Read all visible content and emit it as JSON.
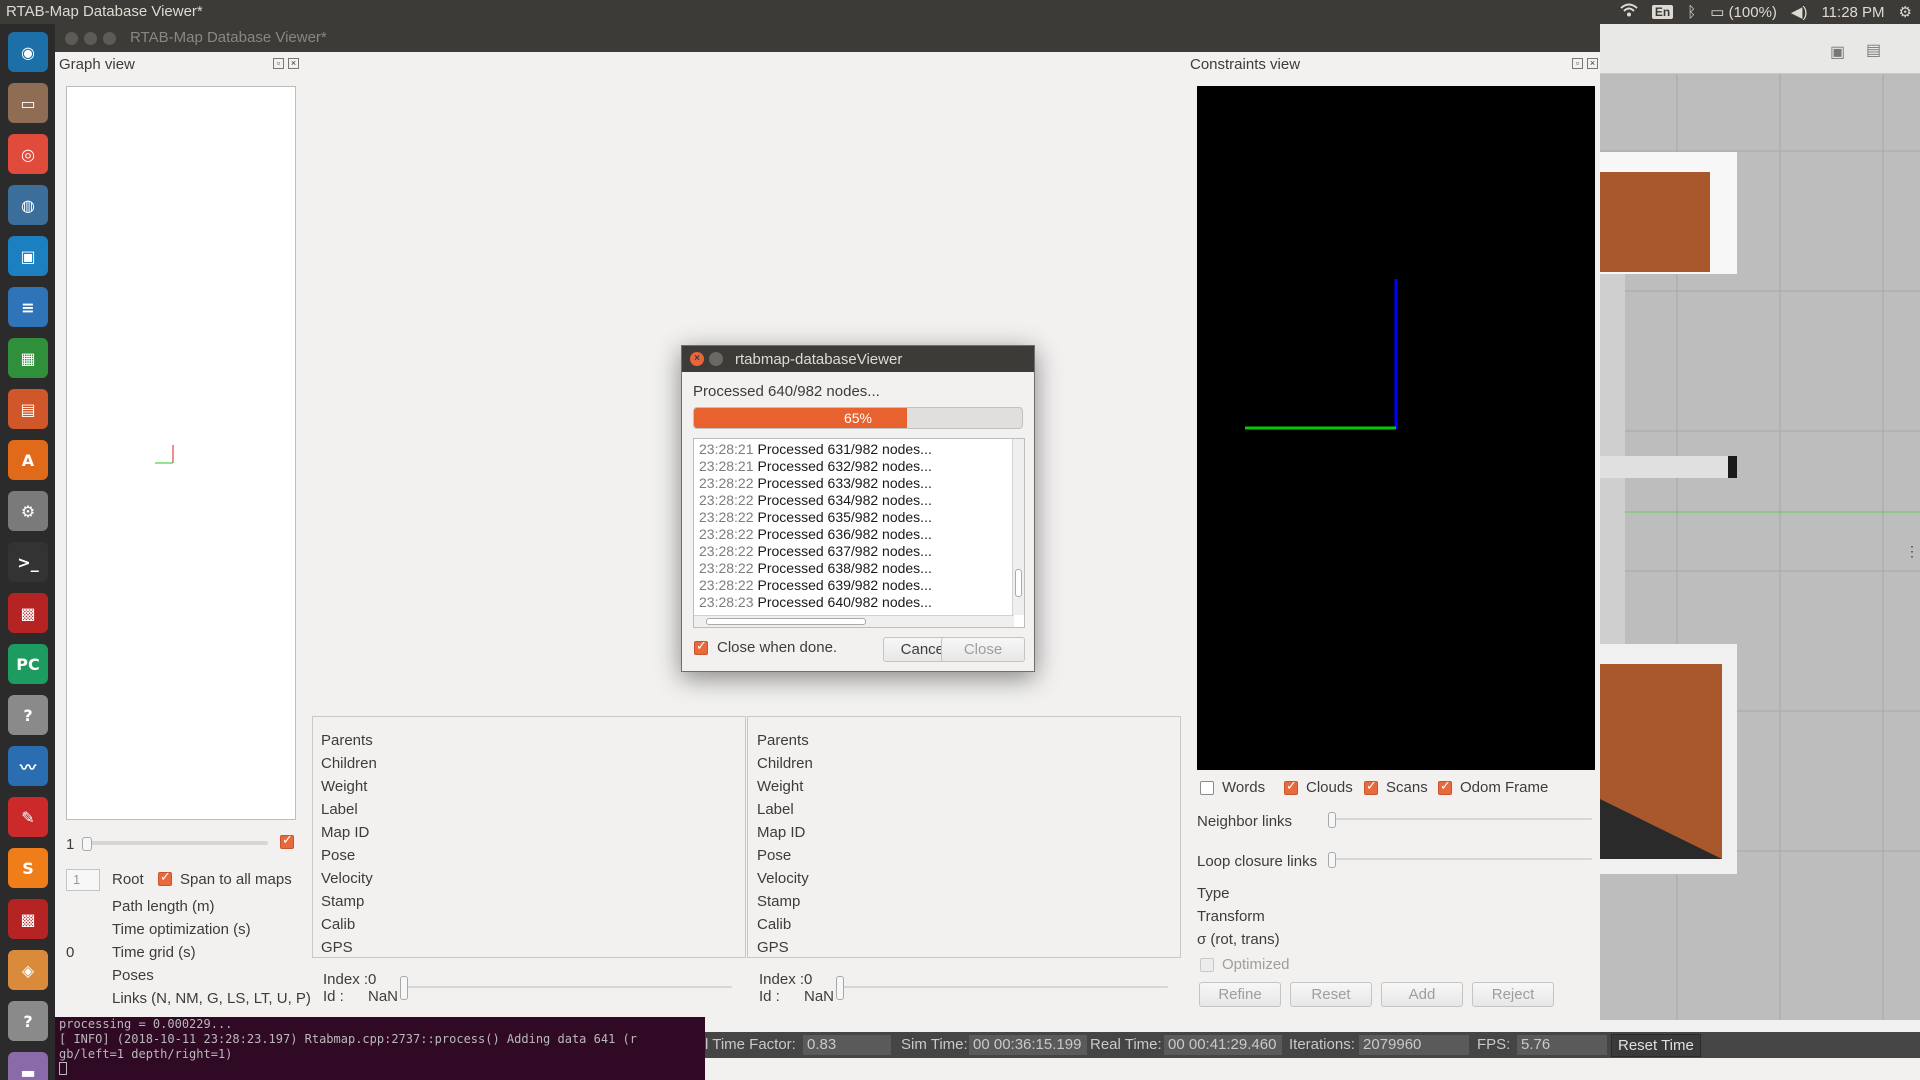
{
  "system": {
    "app_title": "RTAB-Map Database Viewer*",
    "language": "En",
    "battery": "(100%)",
    "clock": "11:28 PM"
  },
  "window": {
    "title": "RTAB-Map Database Viewer*"
  },
  "launcher": {
    "items": [
      {
        "name": "ubuntu-dash-icon",
        "glyph": "◉",
        "color": "#1d6fa8"
      },
      {
        "name": "files-icon",
        "glyph": "▭",
        "color": "#8e6d54"
      },
      {
        "name": "chrome-icon",
        "glyph": "◎",
        "color": "#e14b3b"
      },
      {
        "name": "network-icon",
        "glyph": "◍",
        "color": "#3c6e9c"
      },
      {
        "name": "virtualbox-icon",
        "glyph": "▣",
        "color": "#1c7fc0"
      },
      {
        "name": "writer-icon",
        "glyph": "≡",
        "color": "#2f73b8"
      },
      {
        "name": "calc-icon",
        "glyph": "▦",
        "color": "#2f8f3a"
      },
      {
        "name": "impress-icon",
        "glyph": "▤",
        "color": "#d0572a"
      },
      {
        "name": "software-center-icon",
        "glyph": "A",
        "color": "#e06a1a"
      },
      {
        "name": "settings-icon",
        "glyph": "⚙",
        "color": "#7a7a7a"
      },
      {
        "name": "terminal-icon",
        "glyph": ">_",
        "color": "#333333"
      },
      {
        "name": "rtabmap-icon",
        "glyph": "▩",
        "color": "#b52323"
      },
      {
        "name": "pycharm-icon",
        "glyph": "PC",
        "color": "#1c9c5e"
      },
      {
        "name": "help-icon",
        "glyph": "?",
        "color": "#8a8a8a"
      },
      {
        "name": "monitor-icon",
        "glyph": "〰",
        "color": "#2a6db0"
      },
      {
        "name": "text-editor-icon",
        "glyph": "✎",
        "color": "#cc2a2a"
      },
      {
        "name": "sublime-icon",
        "glyph": "S",
        "color": "#ef7d1a"
      },
      {
        "name": "rtabmap2-icon",
        "glyph": "▩",
        "color": "#b52323"
      },
      {
        "name": "gazebo-icon",
        "glyph": "◈",
        "color": "#d98a3a"
      },
      {
        "name": "help2-icon",
        "glyph": "?",
        "color": "#8a8a8a"
      },
      {
        "name": "disk-icon",
        "glyph": "▬",
        "color": "#8a6aa8"
      }
    ]
  },
  "graph_view": {
    "title": "Graph view",
    "slider_value": "1",
    "spin_value": "1",
    "root_label": "Root",
    "span_label": "Span to all maps",
    "path_length": "Path length (m)",
    "time_optimization": "Time optimization (s)",
    "time_grid_value": "0",
    "time_grid": "Time grid (s)",
    "poses": "Poses",
    "links": "Links (N, NM, G, LS, LT, U, P)"
  },
  "node_info": {
    "labels": [
      "Parents",
      "Children",
      "Weight",
      "Label",
      "Map ID",
      "Pose",
      "Velocity",
      "Stamp",
      "Calib",
      "GPS"
    ],
    "left": {
      "index": "Index :0",
      "id_label": "Id :",
      "id_value": "NaN"
    },
    "right": {
      "index": "Index :0",
      "id_label": "Id :",
      "id_value": "NaN"
    }
  },
  "constraints_view": {
    "title": "Constraints view",
    "checks": [
      {
        "label": "Words",
        "checked": false
      },
      {
        "label": "Clouds",
        "checked": true
      },
      {
        "label": "Scans",
        "checked": true
      },
      {
        "label": "Odom Frame",
        "checked": true
      }
    ],
    "neighbor_links": "Neighbor links",
    "loop_closure_links": "Loop closure links",
    "type": "Type",
    "transform": "Transform",
    "sigma": "σ (rot, trans)",
    "optimized": "Optimized",
    "buttons": {
      "refine": "Refine",
      "reset": "Reset",
      "add": "Add",
      "reject": "Reject"
    }
  },
  "dialog": {
    "title": "rtabmap-databaseViewer",
    "status": "Processed 640/982 nodes...",
    "progress_text": "65%",
    "progress": 0.65,
    "log": [
      {
        "time": "23:28:21",
        "msg": "Processed 631/982 nodes..."
      },
      {
        "time": "23:28:21",
        "msg": "Processed 632/982 nodes..."
      },
      {
        "time": "23:28:22",
        "msg": "Processed 633/982 nodes..."
      },
      {
        "time": "23:28:22",
        "msg": "Processed 634/982 nodes..."
      },
      {
        "time": "23:28:22",
        "msg": "Processed 635/982 nodes..."
      },
      {
        "time": "23:28:22",
        "msg": "Processed 636/982 nodes..."
      },
      {
        "time": "23:28:22",
        "msg": "Processed 637/982 nodes..."
      },
      {
        "time": "23:28:22",
        "msg": "Processed 638/982 nodes..."
      },
      {
        "time": "23:28:22",
        "msg": "Processed 639/982 nodes..."
      },
      {
        "time": "23:28:23",
        "msg": "Processed 640/982 nodes..."
      }
    ],
    "close_when_done": "Close when done.",
    "cancel": "Cancel",
    "close": "Close"
  },
  "terminal": {
    "lines": [
      "processing = 0.000229...",
      "[ INFO] (2018-10-11 23:28:23.197) Rtabmap.cpp:2737::process() Adding data 641 (r",
      "gb/left=1 depth/right=1)"
    ]
  },
  "gazebo_status": {
    "time_factor_label": "l Time Factor:",
    "time_factor": "0.83",
    "sim_time_label": "Sim Time:",
    "sim_time": "00 00:36:15.199",
    "real_time_label": "Real Time:",
    "real_time": "00 00:41:29.460",
    "iterations_label": "Iterations:",
    "iterations": "2079960",
    "fps_label": "FPS:",
    "fps": "5.76",
    "reset_time": "Reset Time"
  }
}
